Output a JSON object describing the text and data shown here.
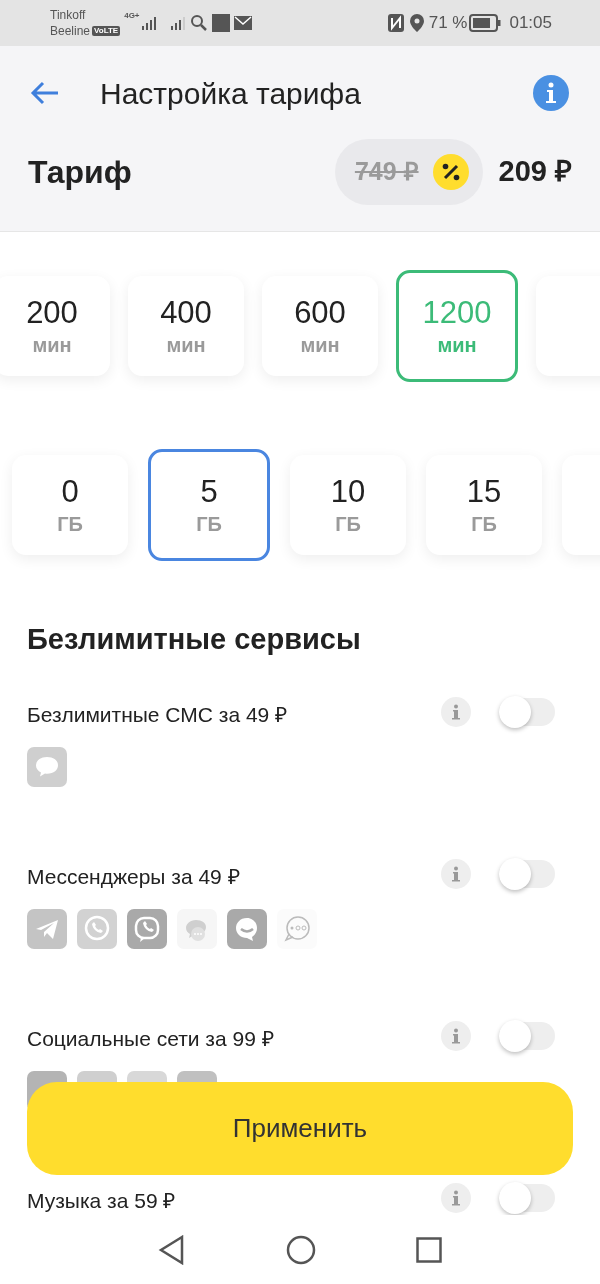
{
  "status_bar": {
    "carrier_1": "Tinkoff",
    "carrier_2": "Beeline",
    "volte": "VoLTE",
    "network": "4G+",
    "battery": "71 %",
    "time": "01:05"
  },
  "header": {
    "title": "Настройка тарифа"
  },
  "tariff": {
    "label": "Тариф",
    "old_price": "749 ₽",
    "price": "209 ₽"
  },
  "minutes": [
    {
      "value": "200",
      "unit": "мин",
      "selected": false
    },
    {
      "value": "400",
      "unit": "мин",
      "selected": false
    },
    {
      "value": "600",
      "unit": "мин",
      "selected": false
    },
    {
      "value": "1200",
      "unit": "мин",
      "selected": true
    }
  ],
  "gigabytes": [
    {
      "value": "0",
      "unit": "ГБ",
      "selected": false
    },
    {
      "value": "5",
      "unit": "ГБ",
      "selected": true
    },
    {
      "value": "10",
      "unit": "ГБ",
      "selected": false
    },
    {
      "value": "15",
      "unit": "ГБ",
      "selected": false
    }
  ],
  "services_title": "Безлимитные сервисы",
  "services": [
    {
      "kind": "sms",
      "label": "Безлимитные СМС за 49 ₽",
      "on": false
    },
    {
      "kind": "messengers",
      "label": "Мессенджеры за 49 ₽",
      "on": false
    },
    {
      "kind": "social",
      "label": "Социальные сети за 99 ₽",
      "on": false
    },
    {
      "kind": "music",
      "label": "Музыка за 59 ₽",
      "on": false
    }
  ],
  "apply_button": "Применить"
}
